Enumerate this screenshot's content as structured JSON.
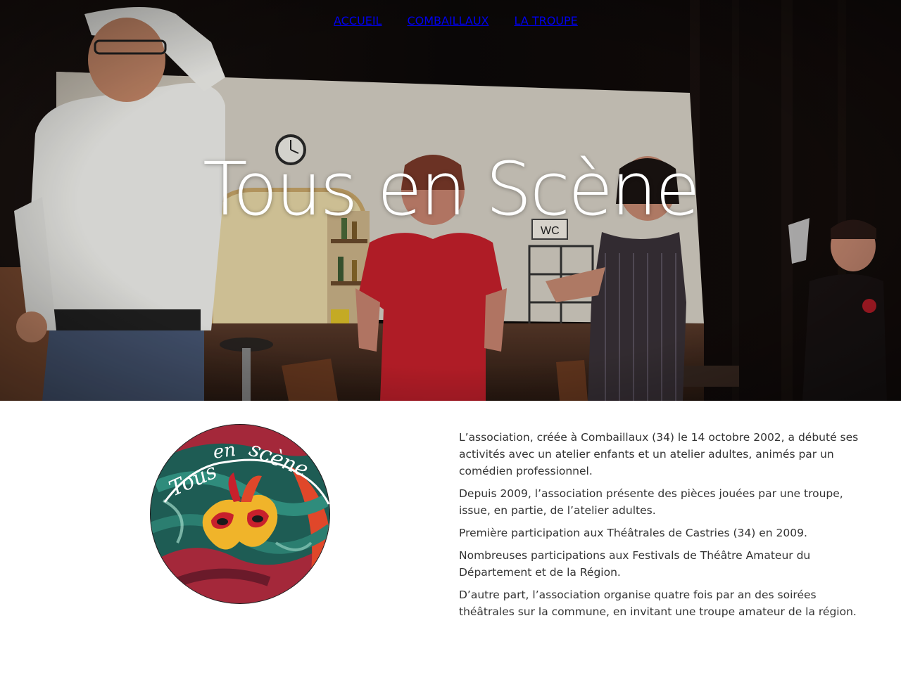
{
  "nav": {
    "items": [
      {
        "label": "ACCUEIL",
        "active": true
      },
      {
        "label": "COMBAILLAUX",
        "active": false
      },
      {
        "label": "LA TROUPE",
        "active": false
      }
    ],
    "active_color": "#e3141b"
  },
  "hero": {
    "title": "Tous en Scène",
    "image_description_icon": "theatre-stage-photo"
  },
  "logo": {
    "text": "Tous en scène",
    "icon": "carnival-mask-icon"
  },
  "about": {
    "paragraphs": [
      "L’association, créée à Combaillaux (34) le 14 octobre 2002, a débuté ses activités avec un atelier enfants et un atelier adultes, animés par un comédien professionnel.",
      "Depuis 2009, l’association présente des pièces jouées par une troupe, issue, en partie, de l’atelier adultes.",
      "Première participation aux Théâtrales de Castries (34) en 2009.",
      "Nombreuses participations aux Festivals de Théâtre Amateur du Département et de la Région.",
      "D’autre part, l’association organise quatre fois par an des soirées théâtrales sur la commune, en invitant une troupe amateur de la région."
    ]
  }
}
